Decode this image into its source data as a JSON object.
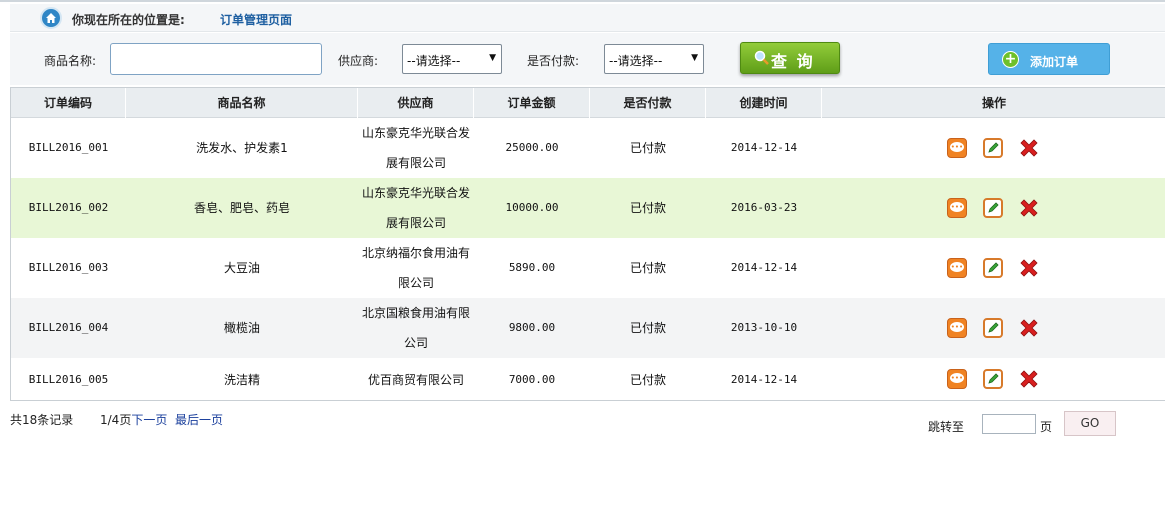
{
  "breadcrumb": {
    "label": "你现在所在的位置是:",
    "current": "订单管理页面",
    "icon": "home-icon"
  },
  "search": {
    "product_label": "商品名称:",
    "product_value": "",
    "supplier_label": "供应商:",
    "supplier_selected": "--请选择--",
    "paid_label": "是否付款:",
    "paid_selected": "--请选择--",
    "query_label": "查 询",
    "add_label": "添加订单"
  },
  "table": {
    "columns": [
      "订单编码",
      "商品名称",
      "供应商",
      "订单金额",
      "是否付款",
      "创建时间",
      "操作"
    ],
    "rows": [
      {
        "code": "BILL2016_001",
        "product": "洗发水、护发素1",
        "supplier": "山东豪克华光联合发展有限公司",
        "amount": "25000.00",
        "paid": "已付款",
        "created": "2014-12-14"
      },
      {
        "code": "BILL2016_002",
        "product": "香皂、肥皂、药皂",
        "supplier": "山东豪克华光联合发展有限公司",
        "amount": "10000.00",
        "paid": "已付款",
        "created": "2016-03-23"
      },
      {
        "code": "BILL2016_003",
        "product": "大豆油",
        "supplier": "北京纳福尔食用油有限公司",
        "amount": "5890.00",
        "paid": "已付款",
        "created": "2014-12-14"
      },
      {
        "code": "BILL2016_004",
        "product": "橄榄油",
        "supplier": "北京国粮食用油有限公司",
        "amount": "9800.00",
        "paid": "已付款",
        "created": "2013-10-10"
      },
      {
        "code": "BILL2016_005",
        "product": "洗洁精",
        "supplier": "优百商贸有限公司",
        "amount": "7000.00",
        "paid": "已付款",
        "created": "2014-12-14"
      }
    ]
  },
  "pagination": {
    "total": "共18条记录",
    "page_info": "1/4页",
    "next": "下一页",
    "last": "最后一页",
    "jump_label": "跳转至",
    "jump_value": "",
    "unit": "页",
    "go_label": "GO"
  },
  "colors": {
    "selected_row": "#e8f7d6",
    "query_button": "#7cbb2c",
    "add_button": "#55b2e8"
  }
}
